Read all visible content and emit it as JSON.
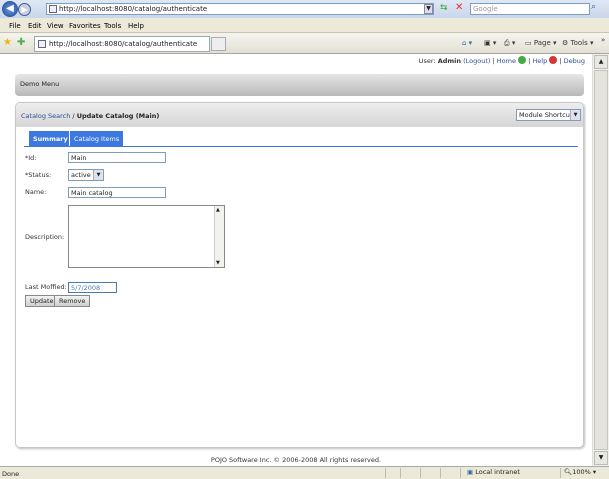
{
  "browser": {
    "url": "http://localhost:8080/catalog/authenticate",
    "search_placeholder": "Google",
    "menu": [
      "File",
      "Edit",
      "View",
      "Favorites",
      "Tools",
      "Help"
    ],
    "tab_title": "http://localhost:8080/catalog/authenticate",
    "toolbar": {
      "page": "Page",
      "tools": "Tools"
    },
    "status": "Done",
    "zone": "Local intranet",
    "zoom": "100%"
  },
  "userbar": {
    "user_label": "User:",
    "user": "Admin",
    "logout": "(Logout)",
    "home": "Home",
    "help": "Help",
    "debug": "Debug"
  },
  "demo_menu": "Demo Menu",
  "breadcrumb": {
    "parent": "Catalog Search",
    "sep": " / ",
    "current": "Update Catalog (Main)"
  },
  "module_shortcuts": "Module Shortcuts",
  "tabs": [
    "Summary",
    "Catalog Items"
  ],
  "form": {
    "id_label": "*Id:",
    "id_value": "Main",
    "status_label": "*Status:",
    "status_value": "active",
    "name_label": "Name:",
    "name_value": "Main catalog",
    "description_label": "Description:",
    "description_value": "",
    "modified_label": "Last Moffied:",
    "modified_value": "5/7/2008",
    "update": "Update",
    "remove": "Remove"
  },
  "footer": "POJO Software Inc. © 2006-2008 All rights reserved."
}
